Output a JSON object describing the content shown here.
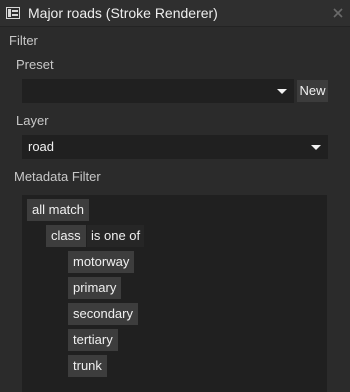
{
  "window": {
    "title": "Major roads (Stroke Renderer)",
    "icon": "stroke-renderer-icon",
    "close_icon": "close-icon"
  },
  "filter": {
    "heading": "Filter",
    "preset": {
      "label": "Preset",
      "value": "",
      "new_button_label": "New"
    },
    "layer": {
      "label": "Layer",
      "value": "road"
    },
    "metadata_filter": {
      "label": "Metadata Filter",
      "root_operator": "all match",
      "condition": {
        "field": "class",
        "operator": "is one of",
        "values": [
          "motorway",
          "primary",
          "secondary",
          "tertiary",
          "trunk"
        ]
      }
    }
  },
  "colors": {
    "background": "#2b2b2b",
    "field_background": "#202020",
    "chip_background": "#3d3d3d",
    "text": "#e6e6e6"
  }
}
